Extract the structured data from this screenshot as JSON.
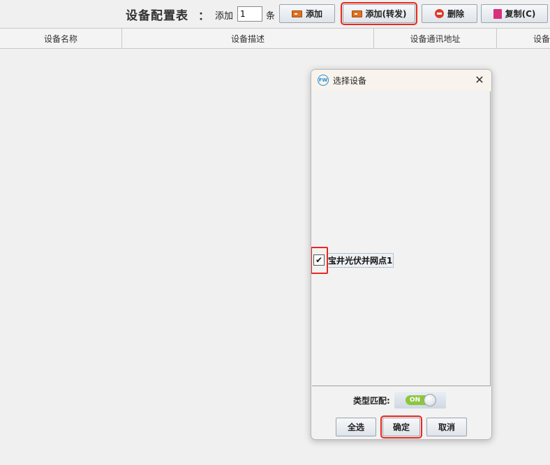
{
  "toolbar": {
    "title": "设备配置表",
    "colon": "：",
    "add_label": "添加",
    "count_value": "1",
    "unit_label": "条",
    "add_button": "添加",
    "add_forward_button": "添加(转发)",
    "delete_button": "删除",
    "copy_button": "复制(C)"
  },
  "table": {
    "columns": [
      "设备名称",
      "设备描述",
      "设备通讯地址",
      "设备"
    ]
  },
  "dialog": {
    "title": "选择设备",
    "logo_text": "FW",
    "close": "✕",
    "items": [
      {
        "label": "宝井光伏并网点1",
        "checked": true,
        "check_glyph": "✔"
      }
    ],
    "type_match_label": "类型匹配:",
    "type_match_toggle": "ON",
    "select_all_button": "全选",
    "ok_button": "确定",
    "cancel_button": "取消"
  },
  "colors": {
    "highlight": "#e8281e",
    "toggle_on": "#8cc63e"
  }
}
